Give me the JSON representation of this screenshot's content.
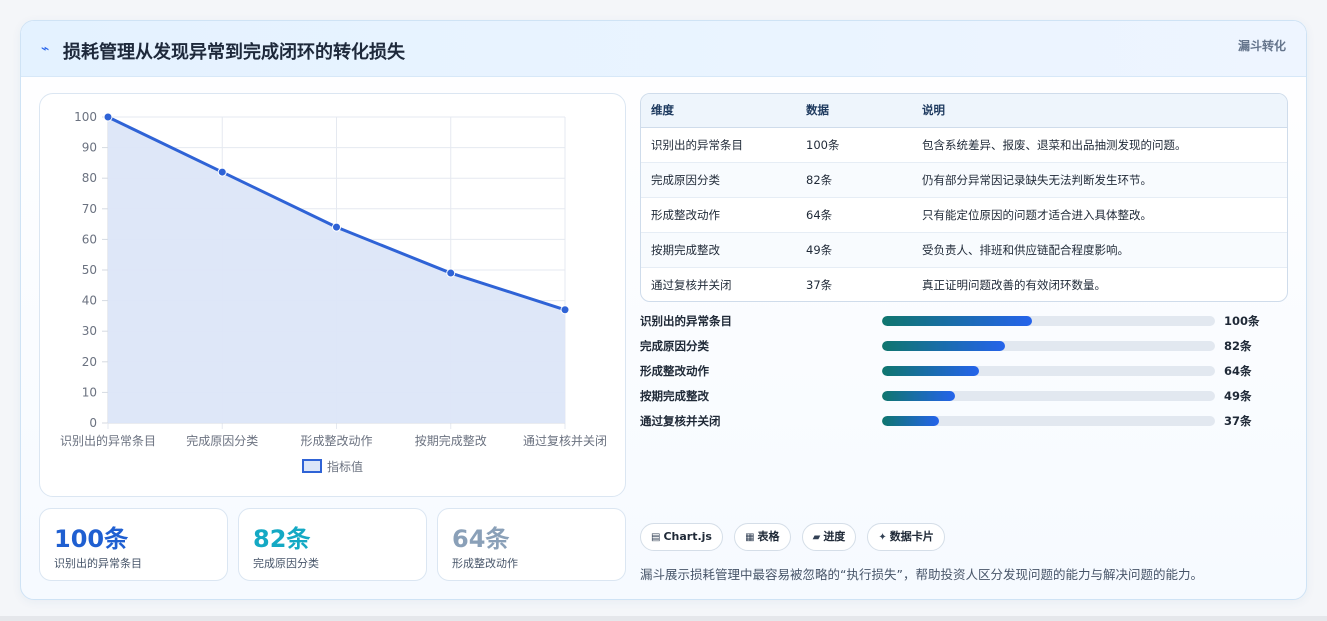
{
  "header": {
    "icon": "chart-line-icon",
    "title": "损耗管理从发现异常到完成闭环的转化损失",
    "tag": "漏斗转化"
  },
  "chart_data": {
    "type": "line",
    "categories": [
      "识别出的异常条目",
      "完成原因分类",
      "形成整改动作",
      "按期完成整改",
      "通过复核并关闭"
    ],
    "series": [
      {
        "name": "指标值",
        "values": [
          100,
          82,
          64,
          49,
          37
        ]
      }
    ],
    "ylim": [
      0,
      100
    ],
    "yticks": [
      0,
      10,
      20,
      30,
      40,
      50,
      60,
      70,
      80,
      90,
      100
    ],
    "legend_position": "bottom",
    "grid": true,
    "colors": {
      "line": "#2f63d6",
      "fill": "#dce6f8"
    }
  },
  "stats": [
    {
      "value": "100条",
      "label": "识别出的异常条目",
      "color": "#1f5fd1"
    },
    {
      "value": "82条",
      "label": "完成原因分类",
      "color": "#14a9c4"
    },
    {
      "value": "64条",
      "label": "形成整改动作",
      "color": "#8aa0b8"
    }
  ],
  "table": {
    "headers": [
      "维度",
      "数据",
      "说明"
    ],
    "rows": [
      [
        "识别出的异常条目",
        "100条",
        "包含系统差异、报废、退菜和出品抽测发现的问题。"
      ],
      [
        "完成原因分类",
        "82条",
        "仍有部分异常因记录缺失无法判断发生环节。"
      ],
      [
        "形成整改动作",
        "64条",
        "只有能定位原因的问题才适合进入具体整改。"
      ],
      [
        "按期完成整改",
        "49条",
        "受负责人、排班和供应链配合程度影响。"
      ],
      [
        "通过复核并关闭",
        "37条",
        "真正证明问题改善的有效闭环数量。"
      ]
    ]
  },
  "progress": [
    {
      "label": "识别出的异常条目",
      "value": "100条",
      "fraction": 0.45
    },
    {
      "label": "完成原因分类",
      "value": "82条",
      "fraction": 0.37
    },
    {
      "label": "形成整改动作",
      "value": "64条",
      "fraction": 0.29
    },
    {
      "label": "按期完成整改",
      "value": "49条",
      "fraction": 0.22
    },
    {
      "label": "通过复核并关闭",
      "value": "37条",
      "fraction": 0.17
    }
  ],
  "chips": [
    {
      "icon": "chart-icon",
      "glyph": "▤",
      "label": "Chart.js"
    },
    {
      "icon": "table-icon",
      "glyph": "▦",
      "label": "表格"
    },
    {
      "icon": "progress-icon",
      "glyph": "▰",
      "label": "进度"
    },
    {
      "icon": "sparkle-icon",
      "glyph": "✦",
      "label": "数据卡片"
    }
  ],
  "footnote": "漏斗展示损耗管理中最容易被忽略的“执行损失”，帮助投资人区分发现问题的能力与解决问题的能力。"
}
